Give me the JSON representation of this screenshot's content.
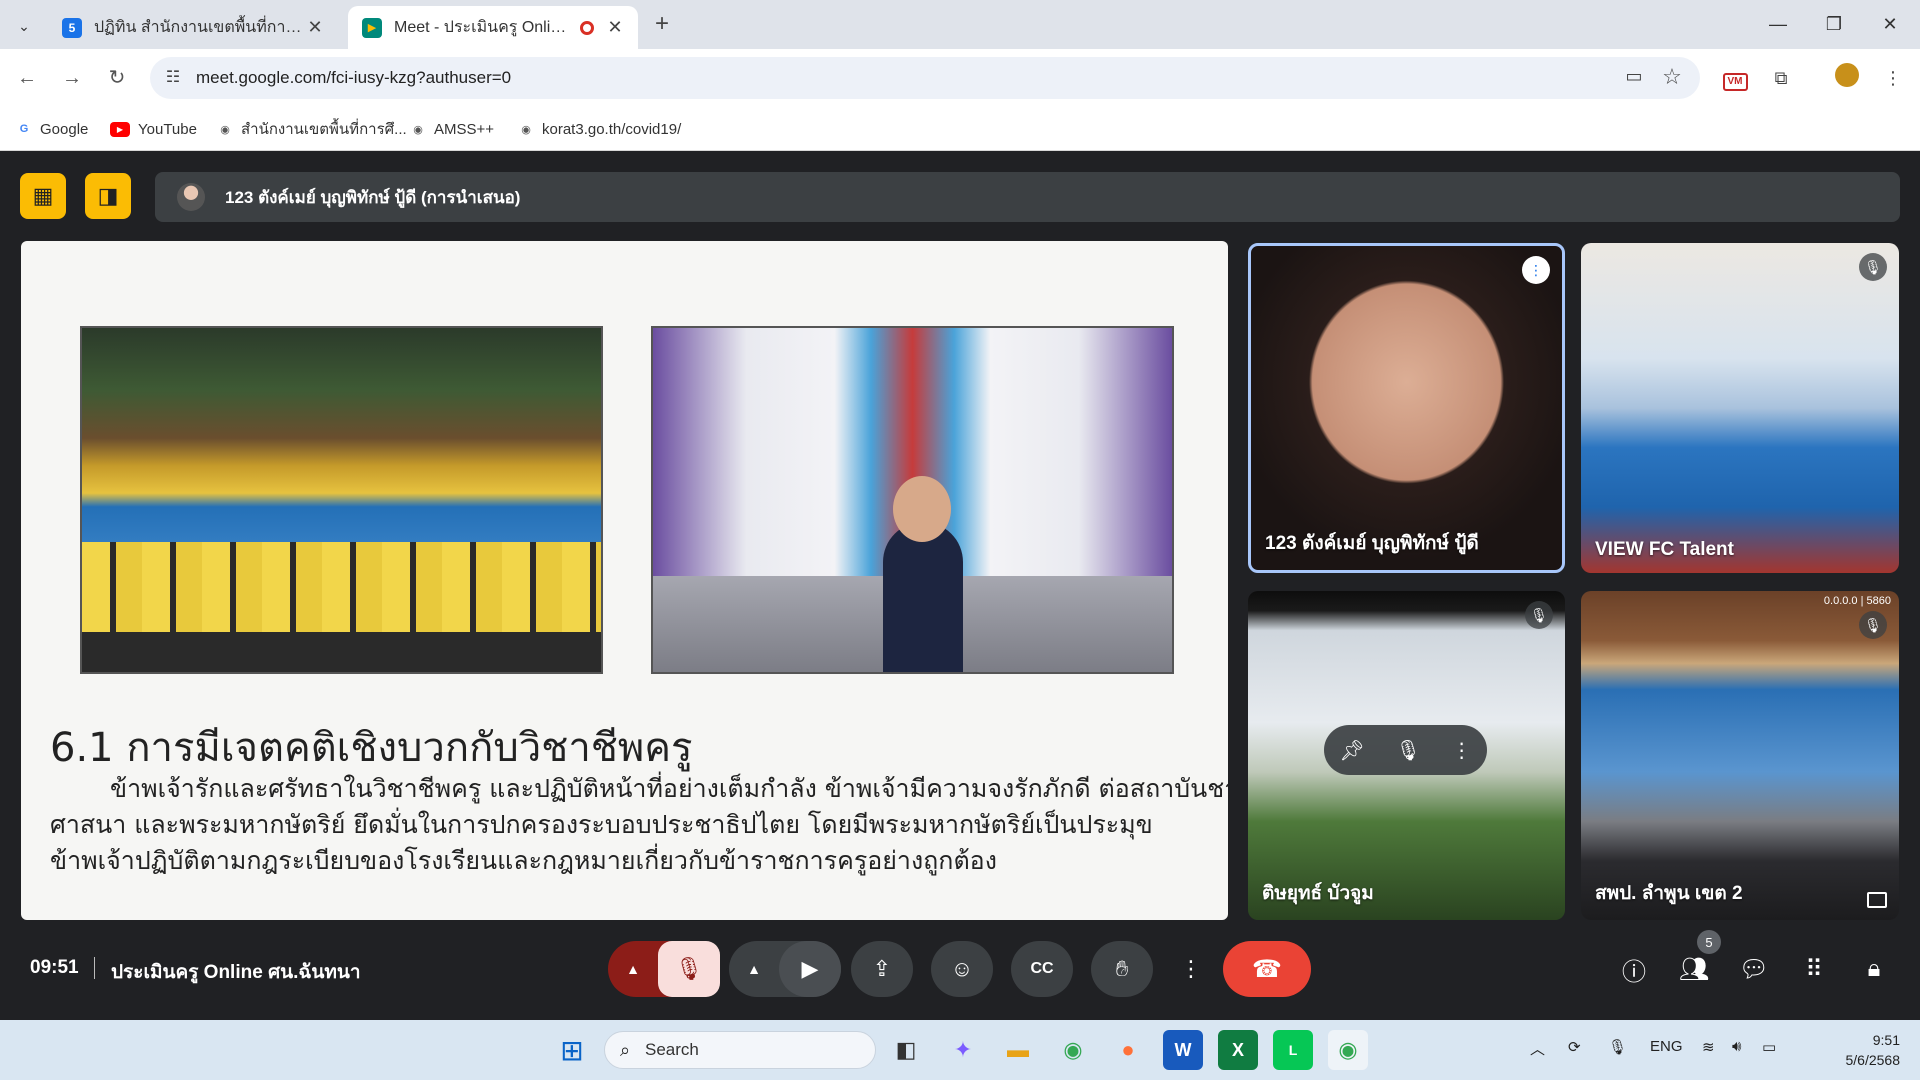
{
  "browser": {
    "tabs": [
      {
        "title": "ปฏิทิน สำนักงานเขตพื้นที่การศึกษาป",
        "favicon_color": "#1a73e8",
        "favicon_glyph": "5"
      },
      {
        "title": "Meet - ประเมินครู Online ศน.",
        "favicon_color": "#00897b",
        "favicon_glyph": "▶"
      }
    ],
    "url": "meet.google.com/fci-iusy-kzg?authuser=0",
    "bookmarks": [
      {
        "label": "Google",
        "color": "#4285f4",
        "glyph": "G"
      },
      {
        "label": "YouTube",
        "color": "#ff0000",
        "glyph": "▶"
      },
      {
        "label": "สำนักงานเขตพื้นที่การศึ...",
        "color": "#555555",
        "glyph": "◉"
      },
      {
        "label": "AMSS++",
        "color": "#555555",
        "glyph": "◉"
      },
      {
        "label": "korat3.go.th/covid19/",
        "color": "#555555",
        "glyph": "◉"
      }
    ],
    "extension_label": "VM"
  },
  "meet": {
    "presenting": "123 ตังค์เมย์ บุญพิทักษ์ ปู้ดี (การนำเสนอ)",
    "slide": {
      "title": "6.1 การมีเจตคติเชิงบวกกับวิชาชีพครู",
      "lines": [
        "ข้าพเจ้ารักและศรัทธาในวิชาชีพครู และปฏิบัติหน้าที่อย่างเต็มกำลัง ข้าพเจ้ามีความจงรักภักดี ต่อสถาบันชาติ",
        "ศาสนา และพระมหากษัตริย์ ยึดมั่นในการปกครองระบอบประชาธิปไตย โดยมีพระมหากษัตริย์เป็นประมุข",
        "ข้าพเจ้าปฏิบัติตามกฎระเบียบของโรงเรียนและกฎหมายเกี่ยวกับข้าราชการครูอย่างถูกต้อง"
      ]
    },
    "participants": [
      {
        "name": "123 ตังค์เมย์ บุญพิทักษ์ ปู้ดี",
        "status": "speaking"
      },
      {
        "name": "VIEW FC Talent",
        "status": "muted"
      },
      {
        "name": "ติษยุทธ์ บัวจูม",
        "status": "muted"
      },
      {
        "name": "สพป. ลำพูน เขต 2",
        "status": "muted",
        "overlay": "0.0.0.0 | 5860"
      }
    ],
    "time": "09:51",
    "meeting_title": "ประเมินครู Online ศน.ฉันทนา",
    "participant_count": "5"
  },
  "taskbar": {
    "search_label": "Search",
    "language": "ENG",
    "time": "9:51",
    "date": "5/6/2568"
  }
}
